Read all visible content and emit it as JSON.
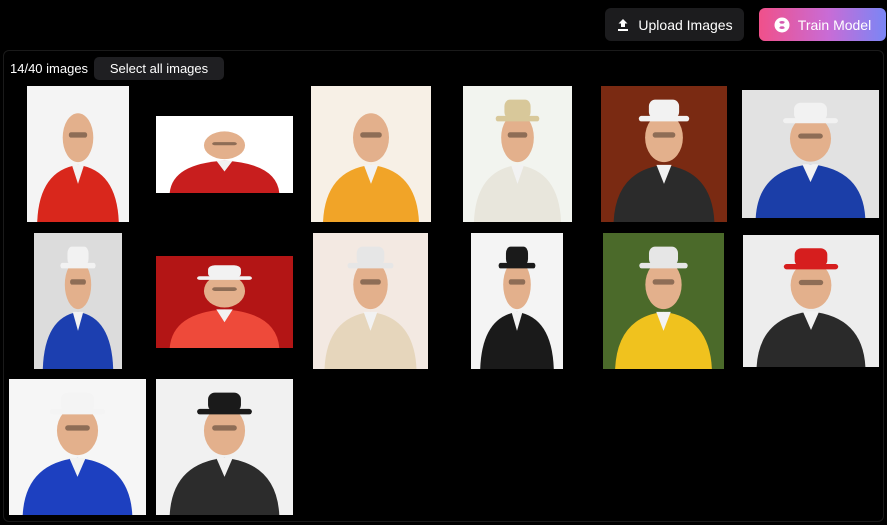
{
  "toolbar": {
    "upload_label": "Upload Images",
    "train_label": "Train Model"
  },
  "gallery": {
    "count_text": "14/40 images",
    "select_all_label": "Select all images",
    "images": [
      {
        "bg": "#f4f4f4",
        "outfit": "#d9271c",
        "hat": ""
      },
      {
        "bg": "#ffffff",
        "outfit": "#c81e1e",
        "hat": ""
      },
      {
        "bg": "#f7f0e6",
        "outfit": "#f1a428",
        "hat": ""
      },
      {
        "bg": "#f2f4ef",
        "outfit": "#e8e6dc",
        "hat": "#d8c89a"
      },
      {
        "bg": "#7a2a12",
        "outfit": "#2b2b2b",
        "hat": "#f2f2f2"
      },
      {
        "bg": "#e2e2e2",
        "outfit": "#1b3ea8",
        "hat": "#f2f2f2"
      },
      {
        "bg": "#dcdcdc",
        "outfit": "#1c3fb0",
        "hat": "#f2f2f2"
      },
      {
        "bg": "#b31515",
        "outfit": "#ee4a3a",
        "hat": "#f2f2f2"
      },
      {
        "bg": "#f3e9e2",
        "outfit": "#e6d6bc",
        "hat": "#e6e6e6"
      },
      {
        "bg": "#f4f4f4",
        "outfit": "#1a1a1a",
        "hat": "#1a1a1a"
      },
      {
        "bg": "#4b6a2a",
        "outfit": "#f0c21e",
        "hat": "#e6e6e6"
      },
      {
        "bg": "#ededed",
        "outfit": "#2a2a2a",
        "hat": "#d61e1e"
      },
      {
        "bg": "#f6f6f6",
        "outfit": "#1d40c0",
        "hat": "#f4f4f4"
      },
      {
        "bg": "#f1f1f1",
        "outfit": "#2c2c2c",
        "hat": "#1a1a1a"
      }
    ]
  }
}
